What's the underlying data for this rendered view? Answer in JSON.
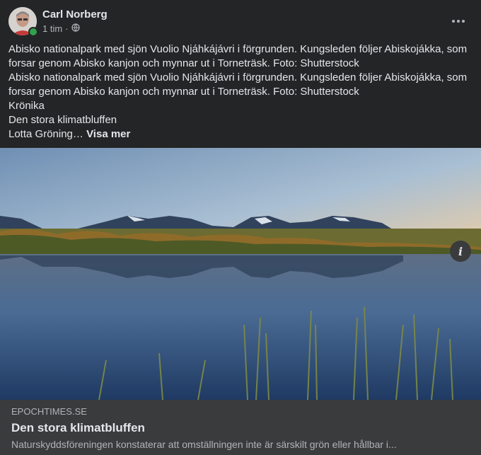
{
  "post": {
    "author": "Carl Norberg",
    "time": "1 tim",
    "separator": "·",
    "audience_icon": "globe-icon",
    "more_icon": "more-options-icon",
    "paragraphs": [
      "Abisko nationalpark med sjön Vuolio Njáhkájávri i förgrunden. Kungsleden följer Abiskojákka, som forsar genom Abisko kanjon och mynnar ut i Torneträsk. Foto: Shutterstock",
      "Abisko nationalpark med sjön Vuolio Njáhkájávri i förgrunden. Kungsleden följer Abiskojákka, som forsar genom Abisko kanjon och mynnar ut i Torneträsk. Foto: Shutterstock",
      "Krönika",
      "Den stora klimatbluffen"
    ],
    "last_line": "Lotta Gröning…",
    "see_more": "Visa mer"
  },
  "link_preview": {
    "domain": "EPOCHTIMES.SE",
    "title": "Den stora klimatbluffen",
    "description": "Naturskyddsföreningen konstaterar att omställningen inte är särskilt grön eller hållbar i...",
    "info_icon": "info-icon"
  },
  "colors": {
    "background": "#242526",
    "preview_bg": "#3a3b3c",
    "online": "#31a24c"
  }
}
